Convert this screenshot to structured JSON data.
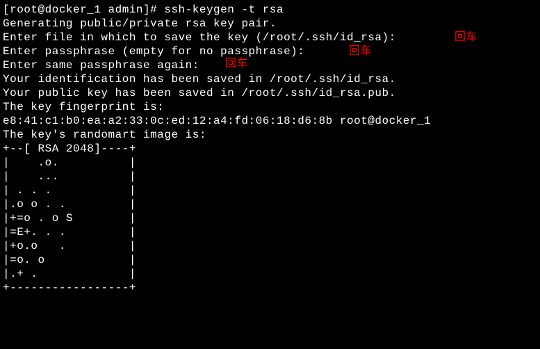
{
  "terminal": {
    "prompt": "[root@docker_1 admin]# ",
    "command": "ssh-keygen -t rsa",
    "lines": [
      "Generating public/private rsa key pair.",
      "Enter file in which to save the key (/root/.ssh/id_rsa):  ",
      "Enter passphrase (empty for no passphrase):  ",
      "Enter same passphrase again:  ",
      "Your identification has been saved in /root/.ssh/id_rsa.",
      "Your public key has been saved in /root/.ssh/id_rsa.pub.",
      "The key fingerprint is:",
      "e8:41:c1:b0:ea:a2:33:0c:ed:12:a4:fd:06:18:d6:8b root@docker_1",
      "The key's randomart image is:",
      "+--[ RSA 2048]----+",
      "|    .o.          |",
      "|    ...          |",
      "| . . .           |",
      "|.o o . .         |",
      "|+=o . o S        |",
      "|=E+. . .         |",
      "|+o.o   .         |",
      "|=o. o            |",
      "|.+ .             |",
      "+-----------------+"
    ],
    "annotations": {
      "enter1": "回车",
      "enter2": "回车",
      "enter3": "回车"
    }
  }
}
